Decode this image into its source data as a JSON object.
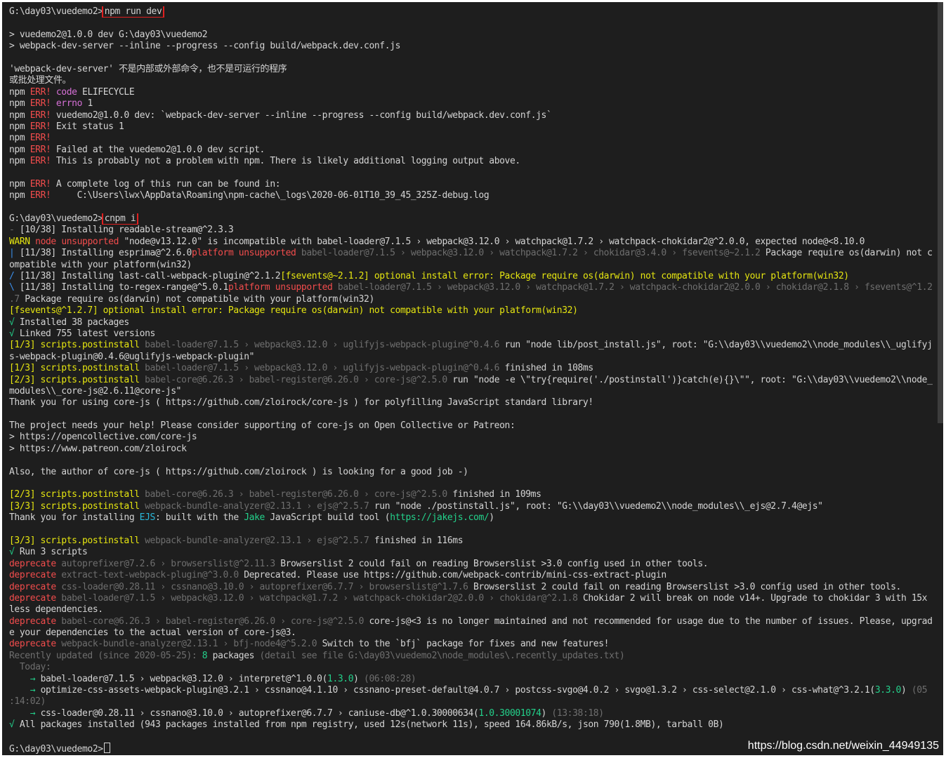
{
  "terminal": {
    "colors": {
      "background": "#1e1e1e",
      "text": "#d4d4d4",
      "error": "#f14c4c",
      "success": "#23d18b",
      "warning": "#e5e510",
      "dim": "#6e6e6e",
      "info": "#3b8eea",
      "highlight_box": "#e02020"
    },
    "lines": [
      [
        {
          "t": "G:\\day03\\vuedemo2>"
        },
        {
          "t": "npm run dev",
          "box": true
        }
      ],
      [],
      [
        {
          "t": "> vuedemo2@1.0.0 dev G:\\day03\\vuedemo2"
        }
      ],
      [
        {
          "t": "> webpack-dev-server --inline --progress --config build/webpack.dev.conf.js"
        }
      ],
      [],
      [
        {
          "t": "'webpack-dev-server' 不是内部或外部命令，也不是可运行的程序"
        }
      ],
      [
        {
          "t": "或批处理文件。"
        }
      ],
      [
        {
          "t": "npm "
        },
        {
          "t": "ERR!",
          "c": "red"
        },
        {
          "t": " "
        },
        {
          "t": "code",
          "c": "magenta"
        },
        {
          "t": " ELIFECYCLE"
        }
      ],
      [
        {
          "t": "npm "
        },
        {
          "t": "ERR!",
          "c": "red"
        },
        {
          "t": " "
        },
        {
          "t": "errno",
          "c": "magenta"
        },
        {
          "t": " 1"
        }
      ],
      [
        {
          "t": "npm "
        },
        {
          "t": "ERR!",
          "c": "red"
        },
        {
          "t": " vuedemo2@1.0.0 dev: `webpack-dev-server --inline --progress --config build/webpack.dev.conf.js`"
        }
      ],
      [
        {
          "t": "npm "
        },
        {
          "t": "ERR!",
          "c": "red"
        },
        {
          "t": " Exit status 1"
        }
      ],
      [
        {
          "t": "npm "
        },
        {
          "t": "ERR!",
          "c": "red"
        }
      ],
      [
        {
          "t": "npm "
        },
        {
          "t": "ERR!",
          "c": "red"
        },
        {
          "t": " Failed at the vuedemo2@1.0.0 dev script."
        }
      ],
      [
        {
          "t": "npm "
        },
        {
          "t": "ERR!",
          "c": "red"
        },
        {
          "t": " This is probably not a problem with npm. There is likely additional logging output above."
        }
      ],
      [],
      [
        {
          "t": "npm "
        },
        {
          "t": "ERR!",
          "c": "red"
        },
        {
          "t": " A complete log of this run can be found in:"
        }
      ],
      [
        {
          "t": "npm "
        },
        {
          "t": "ERR!",
          "c": "red"
        },
        {
          "t": "     C:\\Users\\lwx\\AppData\\Roaming\\npm-cache\\_logs\\2020-06-01T10_39_45_325Z-debug.log"
        }
      ],
      [],
      [
        {
          "t": "G:\\day03\\vuedemo2>"
        },
        {
          "t": "cnpm i",
          "box": true
        }
      ],
      [
        {
          "t": "- ",
          "c": "grey"
        },
        {
          "t": "[10/38] Installing readable-stream@^2.3.3"
        }
      ],
      [
        {
          "t": "WARN",
          "c": "yellow"
        },
        {
          "t": " "
        },
        {
          "t": "node",
          "c": "red"
        },
        {
          "t": " "
        },
        {
          "t": "unsupported",
          "c": "red"
        },
        {
          "t": " \"node@v13.12.0\" is incompatible with babel-loader@7.1.5 › webpack@3.12.0 › watchpack@1.7.2 › watchpack-chokidar2@^2.0.0, expected node@<8.10.0"
        }
      ],
      [
        {
          "t": "| ",
          "c": "blue"
        },
        {
          "t": "[11/38] Installing esprima@^2.6.0"
        },
        {
          "t": "platform unsupported",
          "c": "red"
        },
        {
          "t": " babel-loader@7.1.5 › webpack@3.12.0 › watchpack@1.7.2 › chokidar@3.4.0 › fsevents@~2.1.2",
          "c": "grey"
        },
        {
          "t": " Package require os(darwin) not c"
        }
      ],
      [
        {
          "t": "ompatible with your platform(win32)"
        }
      ],
      [
        {
          "t": "/ ",
          "c": "blue"
        },
        {
          "t": "[11/38] Installing last-call-webpack-plugin@^2.1.2"
        },
        {
          "t": "[fsevents@~2.1.2] optional install error: Package require os(darwin) not compatible with your platform(win32)",
          "c": "yellow"
        }
      ],
      [
        {
          "t": "\\ ",
          "c": "blue"
        },
        {
          "t": "[11/38] Installing to-regex-range@^5.0.1"
        },
        {
          "t": "platform unsupported",
          "c": "red"
        },
        {
          "t": " babel-loader@7.1.5 › webpack@3.12.0 › watchpack@1.7.2 › watchpack-chokidar2@2.0.0 › chokidar@2.1.8 › fsevents@^1.2",
          "c": "grey"
        }
      ],
      [
        {
          "t": ".7",
          "c": "grey"
        },
        {
          "t": " Package require os(darwin) not compatible with your platform(win32)"
        }
      ],
      [
        {
          "t": "[fsevents@^1.2.7] optional install error: Package require os(darwin) not compatible with your platform(win32)",
          "c": "yellow"
        }
      ],
      [
        {
          "t": "√ ",
          "c": "green"
        },
        {
          "t": "Installed 38 packages"
        }
      ],
      [
        {
          "t": "√ ",
          "c": "green"
        },
        {
          "t": "Linked 755 latest versions"
        }
      ],
      [
        {
          "t": "[1/3] scripts.postinstall",
          "c": "yellow"
        },
        {
          "t": " babel-loader@7.1.5 › webpack@3.12.0 › uglifyjs-webpack-plugin@^0.4.6",
          "c": "grey"
        },
        {
          "t": " run \"node lib/post_install.js\", root: \"G:\\\\day03\\\\vuedemo2\\\\node_modules\\\\_uglifyj"
        }
      ],
      [
        {
          "t": "s-webpack-plugin@0.4.6@uglifyjs-webpack-plugin\""
        }
      ],
      [
        {
          "t": "[1/3] scripts.postinstall",
          "c": "yellow"
        },
        {
          "t": " babel-loader@7.1.5 › webpack@3.12.0 › uglifyjs-webpack-plugin@^0.4.6",
          "c": "grey"
        },
        {
          "t": " finished in 108ms"
        }
      ],
      [
        {
          "t": "[2/3] scripts.postinstall",
          "c": "yellow"
        },
        {
          "t": " babel-core@6.26.3 › babel-register@6.26.0 › core-js@^2.5.0",
          "c": "grey"
        },
        {
          "t": " run \"node -e \\\"try{require('./postinstall')}catch(e){}\\\"\", root: \"G:\\\\day03\\\\vuedemo2\\\\node_"
        }
      ],
      [
        {
          "t": "modules\\\\_core-js@2.6.11@core-js\""
        }
      ],
      [
        {
          "t": "Thank you for using core-js ( https://github.com/zloirock/core-js ) for polyfilling JavaScript standard library!"
        }
      ],
      [],
      [
        {
          "t": "The project needs your help! Please consider supporting of core-js on Open Collective or Patreon:"
        }
      ],
      [
        {
          "t": "> https://opencollective.com/core-js"
        }
      ],
      [
        {
          "t": "> https://www.patreon.com/zloirock"
        }
      ],
      [],
      [
        {
          "t": "Also, the author of core-js ( https://github.com/zloirock ) is looking for a good job -)"
        }
      ],
      [],
      [
        {
          "t": "[2/3] scripts.postinstall",
          "c": "yellow"
        },
        {
          "t": " babel-core@6.26.3 › babel-register@6.26.0 › core-js@^2.5.0",
          "c": "grey"
        },
        {
          "t": " finished in 109ms"
        }
      ],
      [
        {
          "t": "[3/3] scripts.postinstall",
          "c": "yellow"
        },
        {
          "t": " webpack-bundle-analyzer@2.13.1 › ejs@^2.5.7",
          "c": "grey"
        },
        {
          "t": " run \"node ./postinstall.js\", root: \"G:\\\\day03\\\\vuedemo2\\\\node_modules\\\\_ejs@2.7.4@ejs\""
        }
      ],
      [
        {
          "t": "Thank you for installing "
        },
        {
          "t": "EJS",
          "c": "cyan"
        },
        {
          "t": ": built with the "
        },
        {
          "t": "Jake",
          "c": "green"
        },
        {
          "t": " JavaScript build tool ("
        },
        {
          "t": "https://jakejs.com/",
          "c": "green"
        },
        {
          "t": ")"
        }
      ],
      [],
      [
        {
          "t": "[3/3] scripts.postinstall",
          "c": "yellow"
        },
        {
          "t": " webpack-bundle-analyzer@2.13.1 › ejs@^2.5.7",
          "c": "grey"
        },
        {
          "t": " finished in 116ms"
        }
      ],
      [
        {
          "t": "√ ",
          "c": "green"
        },
        {
          "t": "Run 3 scripts"
        }
      ],
      [
        {
          "t": "deprecate",
          "c": "red"
        },
        {
          "t": " autoprefixer@7.2.6 › browserslist@^2.11.3",
          "c": "grey"
        },
        {
          "t": " Browserslist 2 could fail on reading Browserslist >3.0 config used in other tools."
        }
      ],
      [
        {
          "t": "deprecate",
          "c": "red"
        },
        {
          "t": " extract-text-webpack-plugin@^3.0.0",
          "c": "grey"
        },
        {
          "t": " Deprecated. Please use https://github.com/webpack-contrib/mini-css-extract-plugin"
        }
      ],
      [
        {
          "t": "deprecate",
          "c": "red"
        },
        {
          "t": " css-loader@0.28.11 › cssnano@3.10.0 › autoprefixer@6.7.7 › browserslist@^1.7.6",
          "c": "grey"
        },
        {
          "t": " Browserslist 2 could fail on reading Browserslist >3.0 config used in other tools."
        }
      ],
      [
        {
          "t": "deprecate",
          "c": "red"
        },
        {
          "t": " babel-loader@7.1.5 › webpack@3.12.0 › watchpack@1.7.2 › watchpack-chokidar2@2.0.0 › chokidar@^2.1.8",
          "c": "grey"
        },
        {
          "t": " Chokidar 2 will break on node v14+. Upgrade to chokidar 3 with 15x"
        }
      ],
      [
        {
          "t": "less dependencies."
        }
      ],
      [
        {
          "t": "deprecate",
          "c": "red"
        },
        {
          "t": " babel-core@6.26.3 › babel-register@6.26.0 › core-js@^2.5.0",
          "c": "grey"
        },
        {
          "t": " core-js@<3 is no longer maintained and not recommended for usage due to the number of issues. Please, upgrad"
        }
      ],
      [
        {
          "t": "e your dependencies to the actual version of core-js@3."
        }
      ],
      [
        {
          "t": "deprecate",
          "c": "red"
        },
        {
          "t": " webpack-bundle-analyzer@2.13.1 › bfj-node4@^5.2.0",
          "c": "grey"
        },
        {
          "t": " Switch to the `bfj` package for fixes and new features!"
        }
      ],
      [
        {
          "t": "Recently updated (since 2020-05-25): ",
          "c": "grey"
        },
        {
          "t": "8",
          "c": "green"
        },
        {
          "t": " packages"
        },
        {
          "t": " (detail see file G:\\day03\\vuedemo2\\node_modules\\.recently_updates.txt)",
          "c": "grey"
        }
      ],
      [
        {
          "t": "  Today:",
          "c": "grey"
        }
      ],
      [
        {
          "t": "    → ",
          "c": "green"
        },
        {
          "t": "babel-loader@7.1.5 › webpack@3.12.0 › interpret@^1.0.0("
        },
        {
          "t": "1.3.0",
          "c": "green"
        },
        {
          "t": ")"
        },
        {
          "t": " (06:08:28)",
          "c": "grey"
        }
      ],
      [
        {
          "t": "    → ",
          "c": "green"
        },
        {
          "t": "optimize-css-assets-webpack-plugin@3.2.1 › cssnano@4.1.10 › cssnano-preset-default@4.0.7 › postcss-svgo@4.0.2 › svgo@1.3.2 › css-select@2.1.0 › css-what@^3.2.1("
        },
        {
          "t": "3.3.0",
          "c": "green"
        },
        {
          "t": ")"
        },
        {
          "t": " (05",
          "c": "grey"
        }
      ],
      [
        {
          "t": ":14:02)",
          "c": "grey"
        }
      ],
      [
        {
          "t": "    → ",
          "c": "green"
        },
        {
          "t": "css-loader@0.28.11 › cssnano@3.10.0 › autoprefixer@6.7.7 › caniuse-db@^1.0.30000634("
        },
        {
          "t": "1.0.30001074",
          "c": "green"
        },
        {
          "t": ")"
        },
        {
          "t": " (13:38:18)",
          "c": "grey"
        }
      ],
      [
        {
          "t": "√ ",
          "c": "green"
        },
        {
          "t": "All packages installed (943 packages installed from npm registry, used 12s(network 11s), speed 164.86kB/s, json 790(1.8MB), tarball 0B)"
        }
      ],
      [],
      [
        {
          "t": "G:\\day03\\vuedemo2>"
        },
        {
          "cursor": true
        }
      ]
    ]
  },
  "watermark": "https://blog.csdn.net/weixin_44949135"
}
